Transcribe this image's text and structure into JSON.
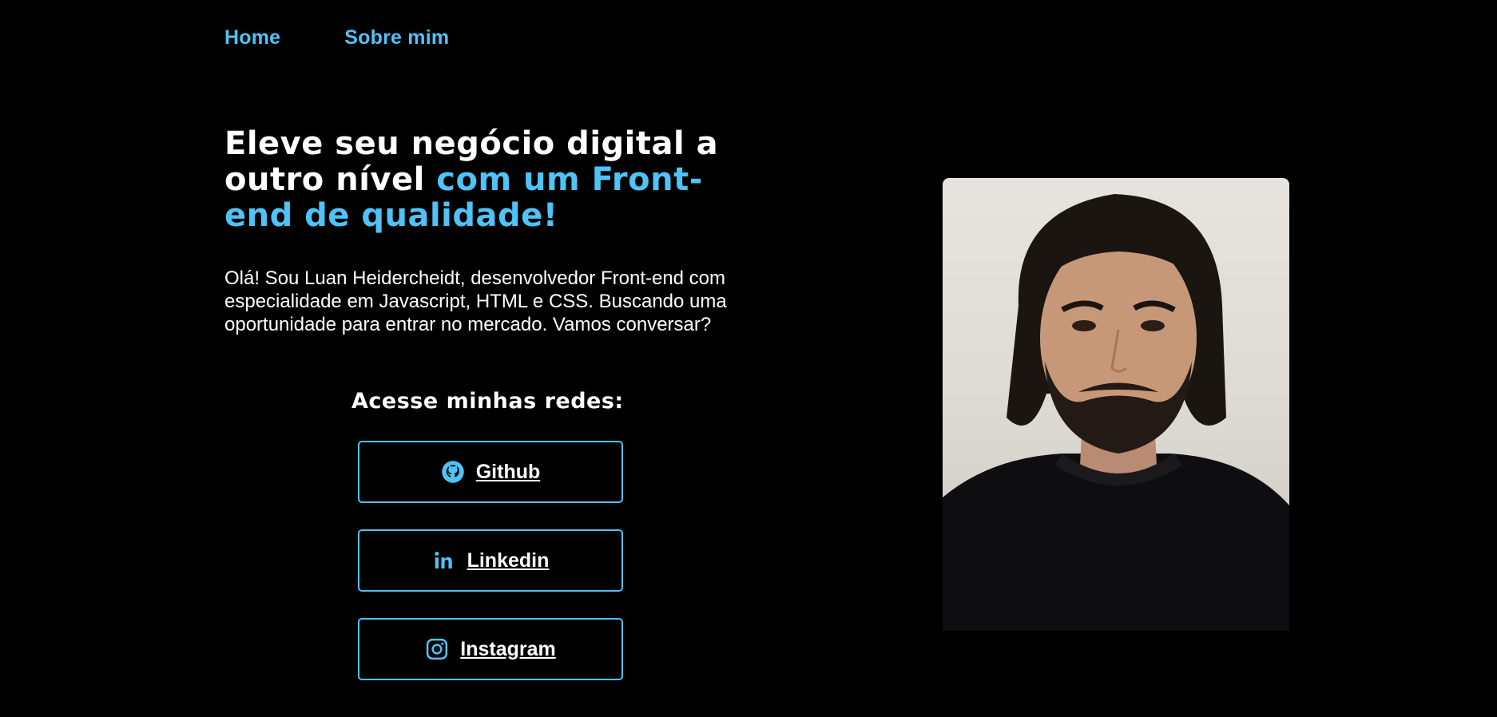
{
  "nav": {
    "home": "Home",
    "about": "Sobre mim"
  },
  "hero": {
    "title_part1": "Eleve seu negócio digital a outro nível ",
    "title_accent": "com um Front-end de qualidade!",
    "intro": "Olá! Sou Luan Heidercheidt, desenvolvedor Front-end com especialidade em Javascript, HTML e CSS. Buscando uma oportunidade para entrar no mercado. Vamos conversar?"
  },
  "socials": {
    "title": "Acesse minhas redes:",
    "links": [
      {
        "label": "Github",
        "icon": "github-icon"
      },
      {
        "label": "Linkedin",
        "icon": "linkedin-icon"
      },
      {
        "label": "Instagram",
        "icon": "instagram-icon"
      }
    ]
  },
  "profile_photo": {
    "description": "profile-photo"
  },
  "colors": {
    "background": "#000000",
    "accent": "#4fc3f7",
    "text": "#ffffff"
  }
}
